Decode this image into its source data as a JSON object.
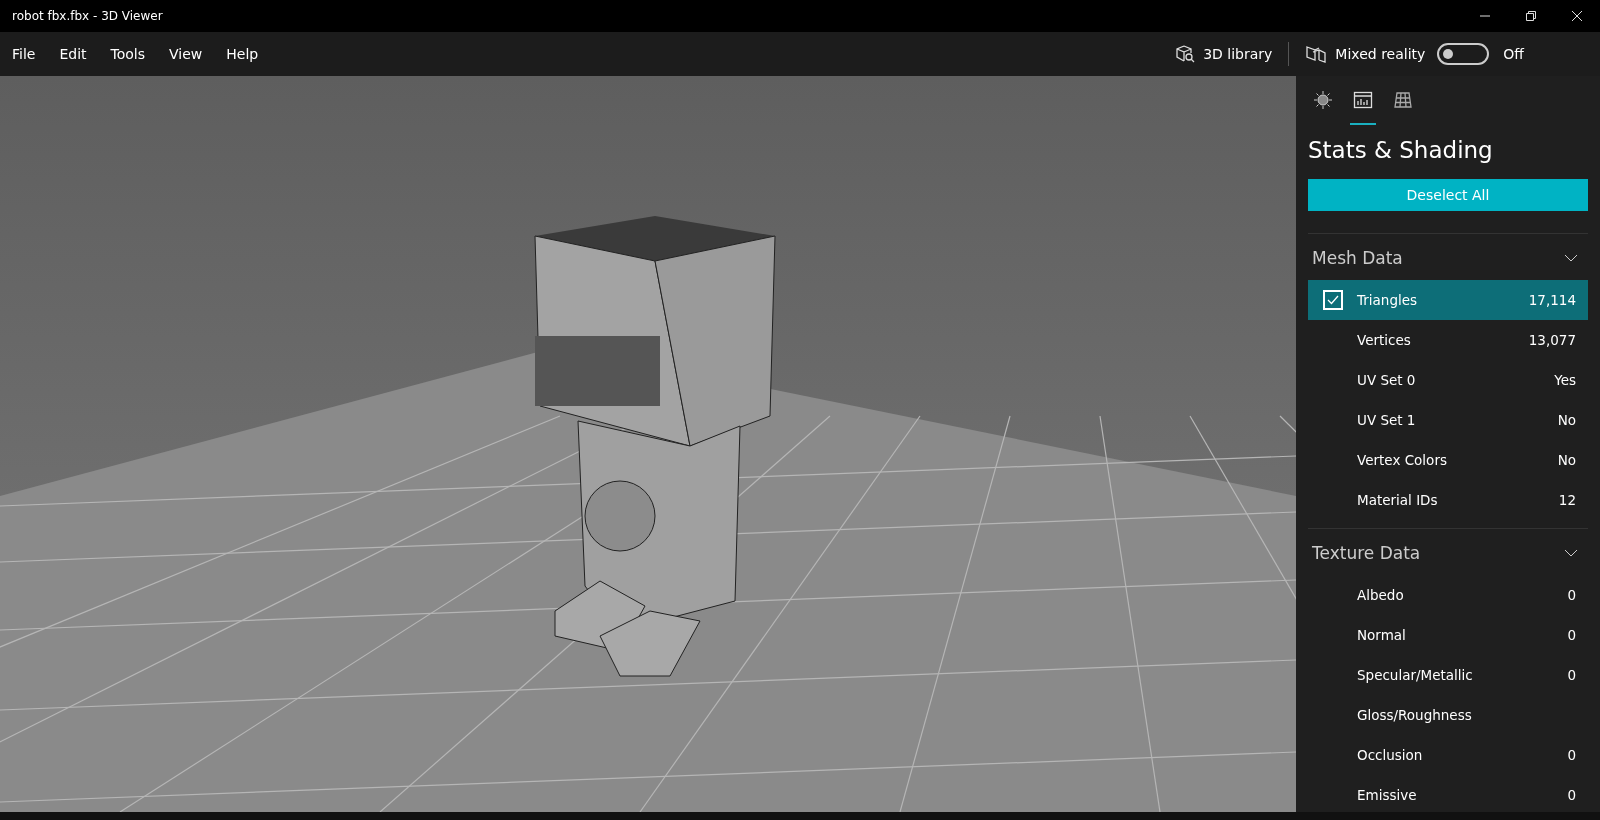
{
  "window": {
    "title": "robot fbx.fbx - 3D Viewer"
  },
  "menu": [
    "File",
    "Edit",
    "Tools",
    "View",
    "Help"
  ],
  "toolbar": {
    "library": "3D library",
    "mixed_reality": {
      "label": "Mixed reality",
      "on": false,
      "state_text": "Off"
    }
  },
  "viewport": {
    "kind": "picture"
  },
  "panel": {
    "tabs": [
      {
        "kind": "lighting",
        "selected": false
      },
      {
        "kind": "stats",
        "selected": true
      },
      {
        "kind": "grid",
        "selected": false
      }
    ],
    "title": "Stats & Shading",
    "button": "Deselect All",
    "sections": [
      {
        "title": "Mesh Data",
        "expanded": true,
        "rows": [
          {
            "label": "Triangles",
            "value": "17,114",
            "checked": true
          },
          {
            "label": "Vertices",
            "value": "13,077",
            "checked": false
          },
          {
            "label": "UV Set 0",
            "value": "Yes",
            "checked": false
          },
          {
            "label": "UV Set 1",
            "value": "No",
            "checked": false
          },
          {
            "label": "Vertex Colors",
            "value": "No",
            "checked": false
          },
          {
            "label": "Material IDs",
            "value": "12",
            "checked": false
          }
        ]
      },
      {
        "title": "Texture Data",
        "expanded": true,
        "rows": [
          {
            "label": "Albedo",
            "value": "0",
            "checked": false
          },
          {
            "label": "Normal",
            "value": "0",
            "checked": false
          },
          {
            "label": "Specular/Metallic",
            "value": "0",
            "checked": false
          },
          {
            "label": "Gloss/Roughness",
            "checked": false
          },
          {
            "label": "Occlusion",
            "value": "0",
            "checked": false
          },
          {
            "label": "Emissive",
            "value": "0",
            "checked": false
          }
        ]
      }
    ]
  }
}
